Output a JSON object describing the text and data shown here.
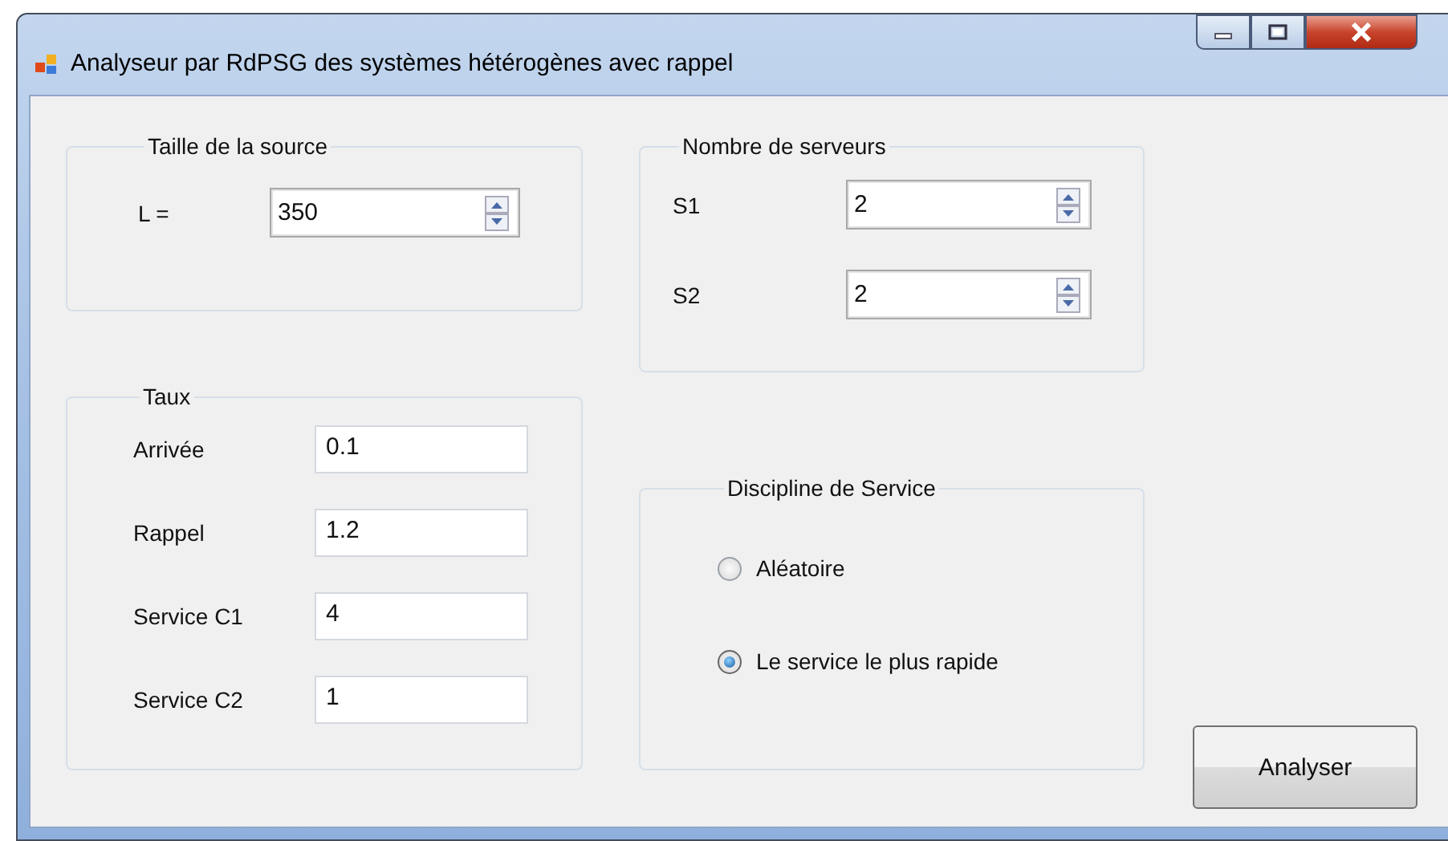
{
  "window": {
    "title": "Analyseur par RdPSG des systèmes hétérogènes avec rappel"
  },
  "source_group": {
    "title": "Taille de la source",
    "fields": [
      {
        "label": "L =",
        "value": "350"
      }
    ]
  },
  "rates_group": {
    "title": "Taux",
    "fields": [
      {
        "label": "Arrivée",
        "value": "0.1"
      },
      {
        "label": "Rappel",
        "value": "1.2"
      },
      {
        "label": "Service C1",
        "value": "4"
      },
      {
        "label": "Service C2",
        "value": "1"
      }
    ]
  },
  "servers_group": {
    "title": "Nombre de serveurs",
    "fields": [
      {
        "label": "S1",
        "value": "2"
      },
      {
        "label": "S2",
        "value": "2"
      }
    ]
  },
  "discipline_group": {
    "title": "Discipline de Service",
    "options": [
      {
        "label": "Aléatoire",
        "selected": false
      },
      {
        "label": "Le service le plus rapide",
        "selected": true
      }
    ]
  },
  "buttons": [
    "Analyser"
  ]
}
